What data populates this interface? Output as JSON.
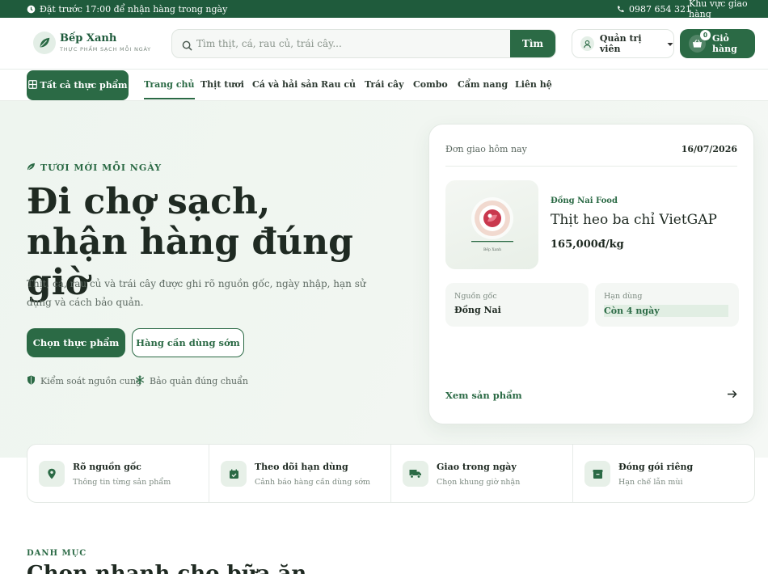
{
  "topbar": {
    "notice": "Đặt trước 17:00 để nhận hàng trong ngày",
    "phone": "0987 654 321",
    "area_link": "Khu vực giao hàng"
  },
  "header": {
    "logo_title": "Bếp Xanh",
    "logo_subtitle": "THỰC PHẨM SẠCH MỖI NGÀY",
    "search_placeholder": "Tìm thịt, cá, rau củ, trái cây...",
    "search_button": "Tìm",
    "account_label": "Quản trị viên",
    "cart_label": "Giỏ hàng",
    "cart_count": "0"
  },
  "nav": {
    "all_categories": "Tất cả thực phẩm",
    "items": [
      "Trang chủ",
      "Thịt tươi",
      "Cá và hải sản",
      "Rau củ",
      "Trái cây",
      "Combo",
      "Cẩm nang",
      "Liên hệ"
    ]
  },
  "hero": {
    "eyebrow": "TƯƠI MỚI MỖI NGÀY",
    "title": "Đi chợ sạch, nhận hàng đúng giờ",
    "description": "Thịt, cá, rau củ và trái cây được ghi rõ nguồn gốc, ngày nhập, hạn sử dụng và cách bảo quản.",
    "primary_button": "Chọn thực phẩm",
    "secondary_button": "Hàng cần dùng sớm",
    "badges": [
      "Kiểm soát nguồn cung",
      "Bảo quản đúng chuẩn"
    ]
  },
  "order_card": {
    "heading": "Đơn giao hôm nay",
    "date": "16/07/2026",
    "image_caption": "Bếp Xanh",
    "brand": "Đồng Nai Food",
    "product_name": "Thịt heo ba chỉ VietGAP",
    "price": "165,000đ/kg",
    "origin_label": "Nguồn gốc",
    "origin_value": "Đồng Nai",
    "expiry_label": "Hạn dùng",
    "expiry_value": "Còn 4 ngày",
    "link_label": "Xem sản phẩm"
  },
  "features": [
    {
      "title": "Rõ nguồn gốc",
      "subtitle": "Thông tin từng sản phẩm",
      "icon": "location-pin-icon"
    },
    {
      "title": "Theo dõi hạn dùng",
      "subtitle": "Cảnh báo hàng cần dùng sớm",
      "icon": "calendar-check-icon"
    },
    {
      "title": "Giao trong ngày",
      "subtitle": "Chọn khung giờ nhận",
      "icon": "truck-icon"
    },
    {
      "title": "Đóng gói riêng",
      "subtitle": "Hạn chế lẫn mùi",
      "icon": "box-icon"
    }
  ],
  "section": {
    "eyebrow": "DANH MỤC",
    "title": "Chọn nhanh cho bữa ăn"
  },
  "colors": {
    "brand_green": "#2b6a45",
    "topbar_green": "#1f5b3c",
    "hero_bg": "#eef5ef"
  }
}
